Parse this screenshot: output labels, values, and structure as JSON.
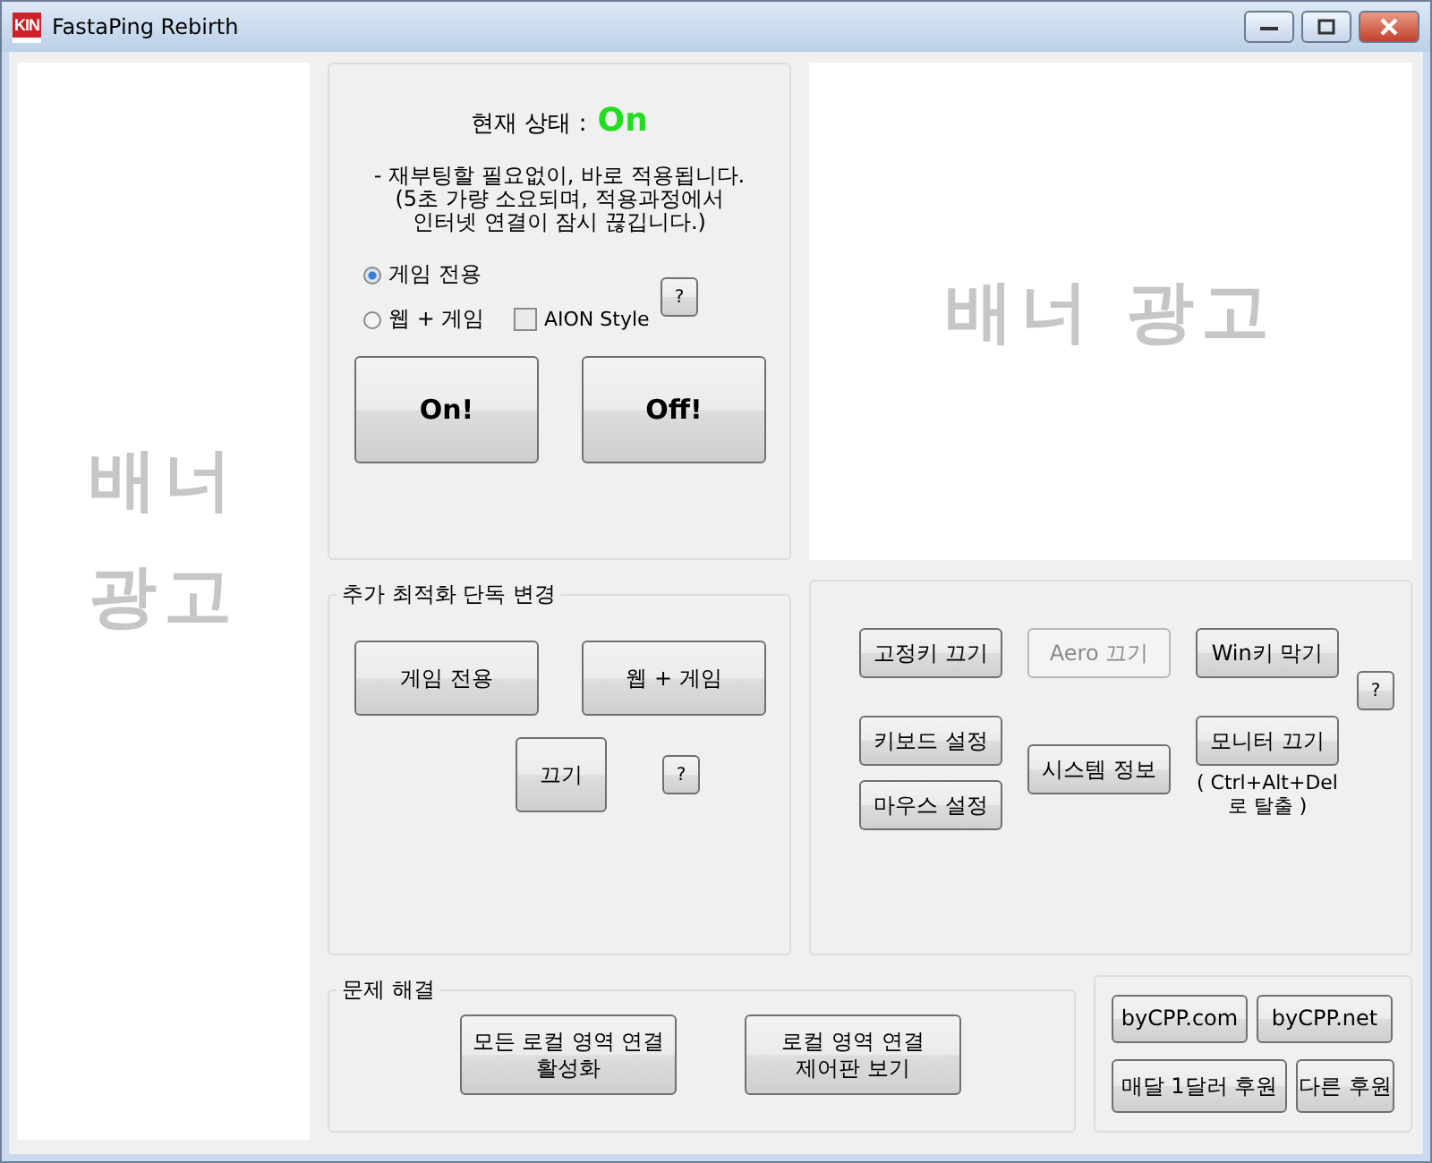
{
  "window": {
    "title": "FastaPing Rebirth",
    "logo": "KIN"
  },
  "left_banner": {
    "lines": [
      "배너",
      "광고"
    ]
  },
  "right_banner": {
    "text": "배너 광고"
  },
  "status": {
    "label": "현재 상태 :",
    "value": "On",
    "on": true
  },
  "note": "- 재부팅할 필요없이, 바로 적용됩니다.\n(5초 가량 소요되며, 적용과정에서\n인터넷 연결이 잠시 끊깁니다.)",
  "modes": [
    {
      "label": "게임 전용",
      "selected": true
    },
    {
      "label": "웹 + 게임",
      "selected": false
    }
  ],
  "aion_style": {
    "label": "AION Style",
    "checked": false
  },
  "mode_help": "?",
  "power_buttons": [
    "On!",
    "Off!"
  ],
  "optimize_group": {
    "title": "추가 최적화 단독 변경",
    "buttons": [
      "게임 전용",
      "웹 + 게임"
    ],
    "off_button": "끄기",
    "help": "?"
  },
  "tools": {
    "buttons": [
      {
        "label": "고정키 끄기",
        "disabled": false
      },
      {
        "label": "키보드 설정",
        "disabled": false
      },
      {
        "label": "마우스 설정",
        "disabled": false
      },
      {
        "label": "Aero 끄기",
        "disabled": true
      },
      {
        "label": "시스템 정보",
        "disabled": false
      },
      {
        "label": "Win키 막기",
        "disabled": false
      },
      {
        "label": "모니터 끄기",
        "disabled": false
      }
    ],
    "note": "( Ctrl+Alt+Del\n로 탈출 )",
    "help": "?"
  },
  "troubleshoot": {
    "title": "문제 해결",
    "buttons": [
      "모든 로컬 영역 연결\n활성화",
      "로컬 영역 연결\n제어판 보기"
    ]
  },
  "links": [
    "byCPP.com",
    "byCPP.net",
    "매달 1달러 후원",
    "다른 후원"
  ]
}
